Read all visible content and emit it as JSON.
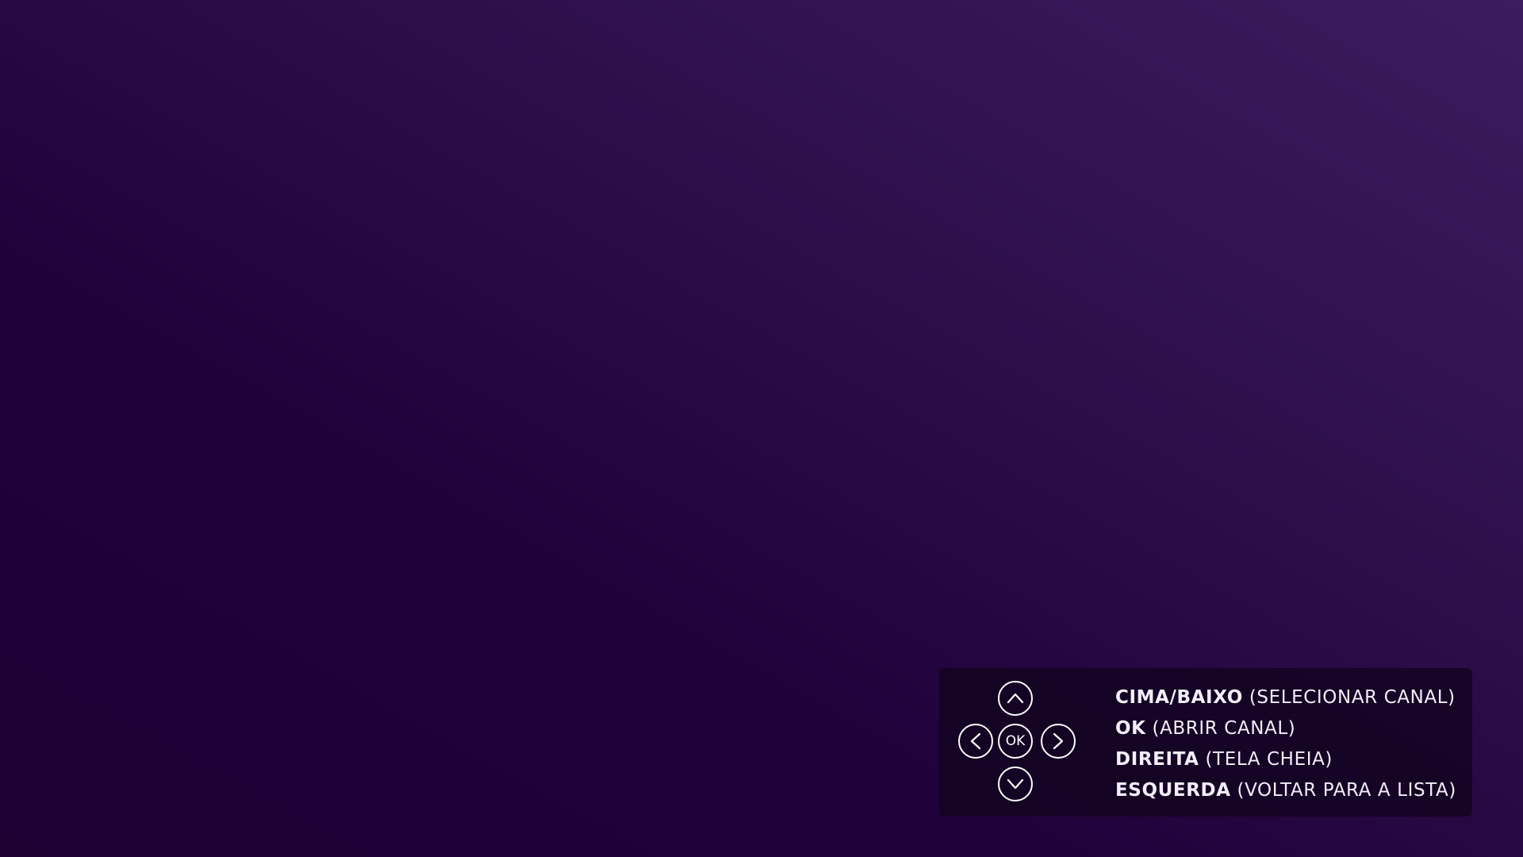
{
  "remote_help": {
    "dpad": {
      "up_icon": "chevron-up-icon",
      "down_icon": "chevron-down-icon",
      "left_icon": "chevron-left-icon",
      "right_icon": "chevron-right-icon",
      "ok_label": "OK"
    },
    "legend": [
      {
        "key": "CIMA/BAIXO",
        "desc": "(SELECIONAR CANAL)"
      },
      {
        "key": "OK",
        "desc": "(ABRIR CANAL)"
      },
      {
        "key": "DIREITA",
        "desc": "(TELA CHEIA)"
      },
      {
        "key": "ESQUERDA",
        "desc": "(VOLTAR PARA A LISTA)"
      }
    ]
  },
  "colors": {
    "background_dark": "#1e0033",
    "background_light": "#3d1b5d",
    "panel": "#12041e",
    "text": "#f2eefa"
  }
}
